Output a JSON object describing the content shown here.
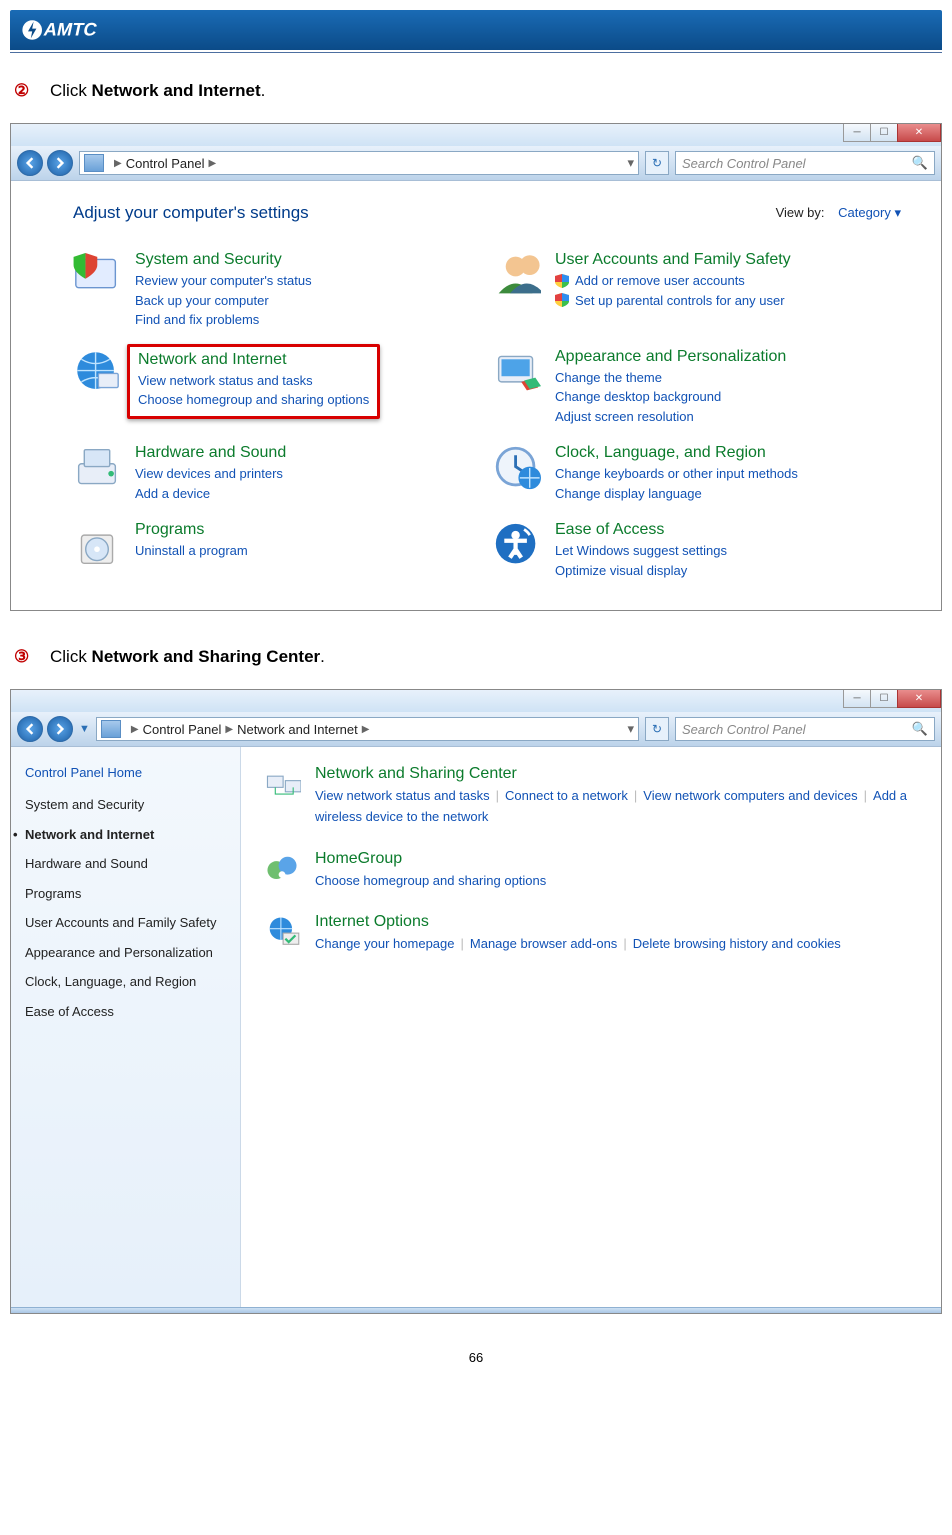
{
  "brand": "AMTC",
  "page_number": "66",
  "step2": {
    "num": "②",
    "prefix": "Click ",
    "bold": "Network and Internet",
    "suffix": "."
  },
  "step3": {
    "num": "③",
    "prefix": "Click ",
    "bold": "Network and Sharing Center",
    "suffix": "."
  },
  "window1": {
    "titlebar_buttons": [
      "min",
      "max",
      "close"
    ],
    "breadcrumb": [
      "Control Panel"
    ],
    "search_placeholder": "Search Control Panel",
    "heading": "Adjust your computer's settings",
    "viewby_label": "View by:",
    "viewby_value": "Category",
    "categories": [
      {
        "title": "System and Security",
        "links": [
          "Review your computer's status",
          "Back up your computer",
          "Find and fix problems"
        ],
        "shields": []
      },
      {
        "title": "User Accounts and Family Safety",
        "links": [
          "Add or remove user accounts",
          "Set up parental controls for any user"
        ],
        "shields": [
          0,
          1
        ]
      },
      {
        "title": "Network and Internet",
        "links": [
          "View network status and tasks",
          "Choose homegroup and sharing options"
        ],
        "highlight": true,
        "shields": []
      },
      {
        "title": "Appearance and Personalization",
        "links": [
          "Change the theme",
          "Change desktop background",
          "Adjust screen resolution"
        ],
        "shields": []
      },
      {
        "title": "Hardware and Sound",
        "links": [
          "View devices and printers",
          "Add a device"
        ],
        "shields": []
      },
      {
        "title": "Clock, Language, and Region",
        "links": [
          "Change keyboards or other input methods",
          "Change display language"
        ],
        "shields": []
      },
      {
        "title": "Programs",
        "links": [
          "Uninstall a program"
        ],
        "shields": []
      },
      {
        "title": "Ease of Access",
        "links": [
          "Let Windows suggest settings",
          "Optimize visual display"
        ],
        "shields": []
      }
    ]
  },
  "window2": {
    "breadcrumb": [
      "Control Panel",
      "Network and Internet"
    ],
    "search_placeholder": "Search Control Panel",
    "sidebar": {
      "home": "Control Panel Home",
      "items": [
        {
          "label": "System and Security",
          "current": false
        },
        {
          "label": "Network and Internet",
          "current": true
        },
        {
          "label": "Hardware and Sound",
          "current": false
        },
        {
          "label": "Programs",
          "current": false
        },
        {
          "label": "User Accounts and Family Safety",
          "current": false
        },
        {
          "label": "Appearance and Personalization",
          "current": false
        },
        {
          "label": "Clock, Language, and Region",
          "current": false
        },
        {
          "label": "Ease of Access",
          "current": false
        }
      ]
    },
    "main": [
      {
        "title": "Network and Sharing Center",
        "links": [
          "View network status and tasks",
          "Connect to a network",
          "View network computers and devices",
          "Add a wireless device to the network"
        ]
      },
      {
        "title": "HomeGroup",
        "links": [
          "Choose homegroup and sharing options"
        ]
      },
      {
        "title": "Internet Options",
        "links": [
          "Change your homepage",
          "Manage browser add-ons",
          "Delete browsing history and cookies"
        ]
      }
    ]
  }
}
